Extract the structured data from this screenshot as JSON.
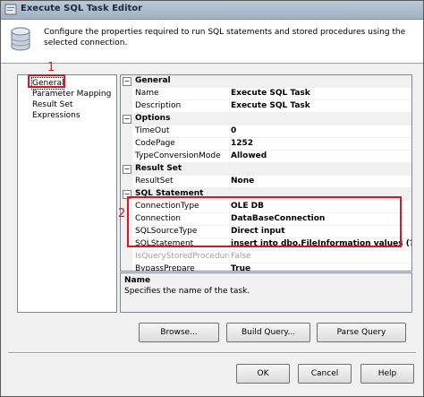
{
  "window": {
    "title": "Execute SQL Task Editor",
    "accent": "#9fb2c6"
  },
  "header": {
    "description": "Configure the properties required to run SQL statements and stored procedures using the selected connection."
  },
  "nav": {
    "items": [
      {
        "label": "General",
        "selected": true
      },
      {
        "label": "Parameter Mapping"
      },
      {
        "label": "Result Set"
      },
      {
        "label": "Expressions"
      }
    ]
  },
  "annotations": {
    "label1": "1",
    "label2": "2",
    "color": "#e0141c"
  },
  "grid": {
    "categories": [
      {
        "title": "General",
        "rows": [
          {
            "key": "Name",
            "value": "Execute SQL Task"
          },
          {
            "key": "Description",
            "value": "Execute SQL Task"
          }
        ]
      },
      {
        "title": "Options",
        "rows": [
          {
            "key": "TimeOut",
            "value": "0"
          },
          {
            "key": "CodePage",
            "value": "1252"
          },
          {
            "key": "TypeConversionMode",
            "value": "Allowed"
          }
        ]
      },
      {
        "title": "Result Set",
        "rows": [
          {
            "key": "ResultSet",
            "value": "None"
          }
        ]
      },
      {
        "title": "SQL Statement",
        "rows": [
          {
            "key": "ConnectionType",
            "value": "OLE DB"
          },
          {
            "key": "Connection",
            "value": "DataBaseConnection"
          },
          {
            "key": "SQLSourceType",
            "value": "Direct input"
          },
          {
            "key": "SQLStatement",
            "value": "insert into dbo.FileInformation values (?)"
          },
          {
            "key": "IsQueryStoredProcedure",
            "value": "False"
          },
          {
            "key": "BypassPrepare",
            "value": "True"
          }
        ]
      }
    ]
  },
  "description_panel": {
    "title": "Name",
    "text": "Specifies the name of the task."
  },
  "buttons": {
    "browse": "Browse...",
    "build_query": "Build Query...",
    "parse_query": "Parse Query",
    "ok": "OK",
    "cancel": "Cancel",
    "help": "Help"
  }
}
